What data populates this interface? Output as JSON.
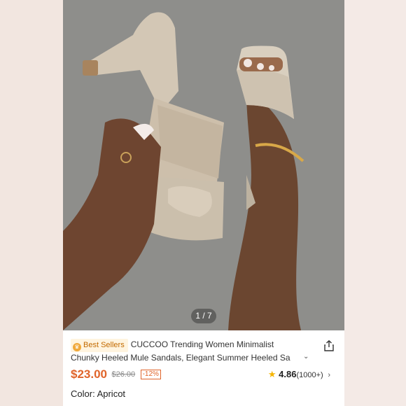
{
  "gallery": {
    "counter": "1 / 7"
  },
  "product": {
    "badge": "Best Sellers",
    "title_line1": "CUCCOO Trending Women Minimalist",
    "title_line2": "Chunky Heeled Mule Sandals, Elegant Summer Heeled Sa",
    "price": "$23.00",
    "original_price": "$26.00",
    "discount": "-12%",
    "rating": "4.86",
    "review_count": "(1000+)",
    "color_label": "Color: Apricot"
  },
  "colors": {
    "accent": "#e0642a",
    "star": "#f5b400",
    "badge_bg": "#fff4df",
    "badge_text": "#c26a00"
  },
  "icons": [
    "crown-icon",
    "share-icon",
    "star-icon",
    "chevron-down-icon",
    "chevron-right-icon"
  ]
}
